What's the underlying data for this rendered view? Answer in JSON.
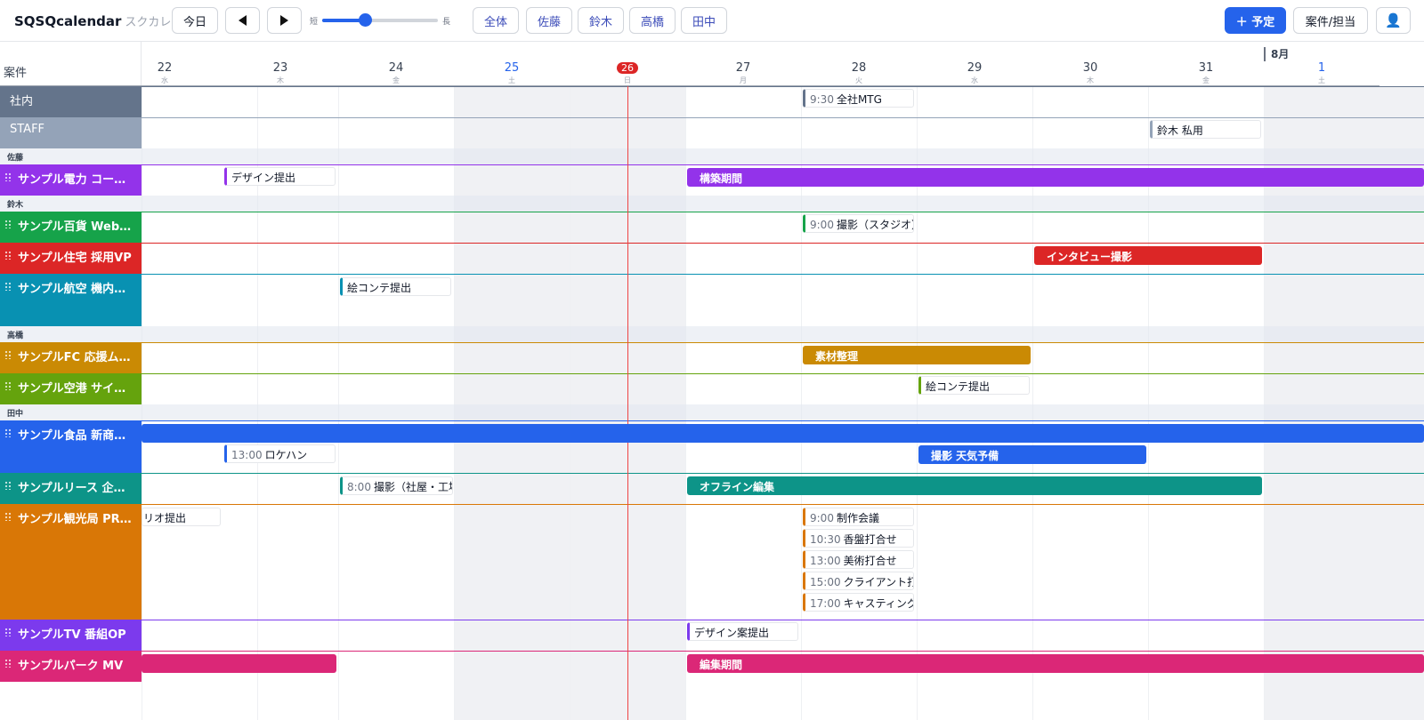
{
  "app": {
    "title": "SQSQcalendar",
    "subtitle": "スクカレ"
  },
  "toolbar": {
    "today_label": "今日",
    "zoom_short": "短",
    "zoom_long": "長",
    "zoom_level": 0.36,
    "filters": [
      "全体",
      "佐藤",
      "鈴木",
      "高橋",
      "田中"
    ],
    "add_label": "＋ 予定",
    "projects_label": "案件/担当",
    "user_icon": "👤"
  },
  "header": {
    "corner_label": "案件",
    "month_label": "8月",
    "days": [
      {
        "num": "22",
        "dow": "水"
      },
      {
        "num": "23",
        "dow": "木"
      },
      {
        "num": "24",
        "dow": "金"
      },
      {
        "num": "25",
        "dow": "土"
      },
      {
        "num": "26",
        "dow": "日"
      },
      {
        "num": "27",
        "dow": "月"
      },
      {
        "num": "28",
        "dow": "火"
      },
      {
        "num": "29",
        "dow": "水"
      },
      {
        "num": "30",
        "dow": "木"
      },
      {
        "num": "31",
        "dow": "金"
      },
      {
        "num": "1",
        "dow": "土"
      }
    ]
  },
  "groups": {
    "sato": "佐藤",
    "suzuki": "鈴木",
    "takahashi": "高橋",
    "tanaka": "田中"
  },
  "rows": {
    "shanai": "社内",
    "staff": "STAFF",
    "denryoku": "サンプル電力 コー…",
    "hyakka": "サンプル百貨 Web…",
    "jutaku": "サンプル住宅 採用VP",
    "koku": "サンプル航空 機内…",
    "fc": "サンプルFC 応援ム…",
    "kuko": "サンプル空港 サイ…",
    "shokuhin": "サンプル食品 新商…",
    "lease": "サンプルリース 企…",
    "kanko": "サンプル観光局 PR…",
    "tv": "サンプルTV 番組OP",
    "park": "サンプルパーク MV"
  },
  "events": {
    "shanai_mtg": {
      "time": "9:30",
      "title": "全社MTG"
    },
    "staff_suzuki": {
      "title": "鈴木 私用"
    },
    "denryoku_design": {
      "title": "デザイン提出"
    },
    "denryoku_build": {
      "title": "構築期間"
    },
    "hyakka_shoot": {
      "time": "9:00",
      "title": "撮影（スタジオ）"
    },
    "jutaku_interview": {
      "title": "インタビュー撮影"
    },
    "koku_ekonte": {
      "title": "絵コンテ提出"
    },
    "fc_sozai": {
      "title": "素材整理"
    },
    "kuko_ekonte": {
      "title": "絵コンテ提出"
    },
    "shokuhin_location": {
      "time": "13:00",
      "title": "ロケハン"
    },
    "shokuhin_shoot": {
      "title": "撮影 天気予備"
    },
    "lease_shoot": {
      "time": "8:00",
      "title": "撮影（社屋・工場"
    },
    "lease_offline": {
      "title": "オフライン編集"
    },
    "kanko_scenario": {
      "title": "リオ提出"
    },
    "kanko_1": {
      "time": "9:00",
      "title": "制作会議"
    },
    "kanko_2": {
      "time": "10:30",
      "title": "香盤打合せ"
    },
    "kanko_3": {
      "time": "13:00",
      "title": "美術打合せ"
    },
    "kanko_4": {
      "time": "15:00",
      "title": "クライアント打"
    },
    "kanko_5": {
      "time": "17:00",
      "title": "キャスティング"
    },
    "tv_design": {
      "title": "デザイン案提出"
    },
    "park_edit": {
      "title": "編集期間"
    }
  },
  "colors": {
    "primary": "#2563eb",
    "today": "#dc2626",
    "shanai": "#64748b",
    "staff": "#94a3b8",
    "purple": "#9333ea",
    "green": "#16a34a",
    "red": "#dc2626",
    "teal": "#0891b2",
    "amber": "#ca8a04",
    "lime": "#65a30d",
    "blue": "#2563eb",
    "emerald": "#0d9488",
    "orange": "#d97706",
    "violet": "#7c3aed",
    "pink": "#db2777"
  }
}
